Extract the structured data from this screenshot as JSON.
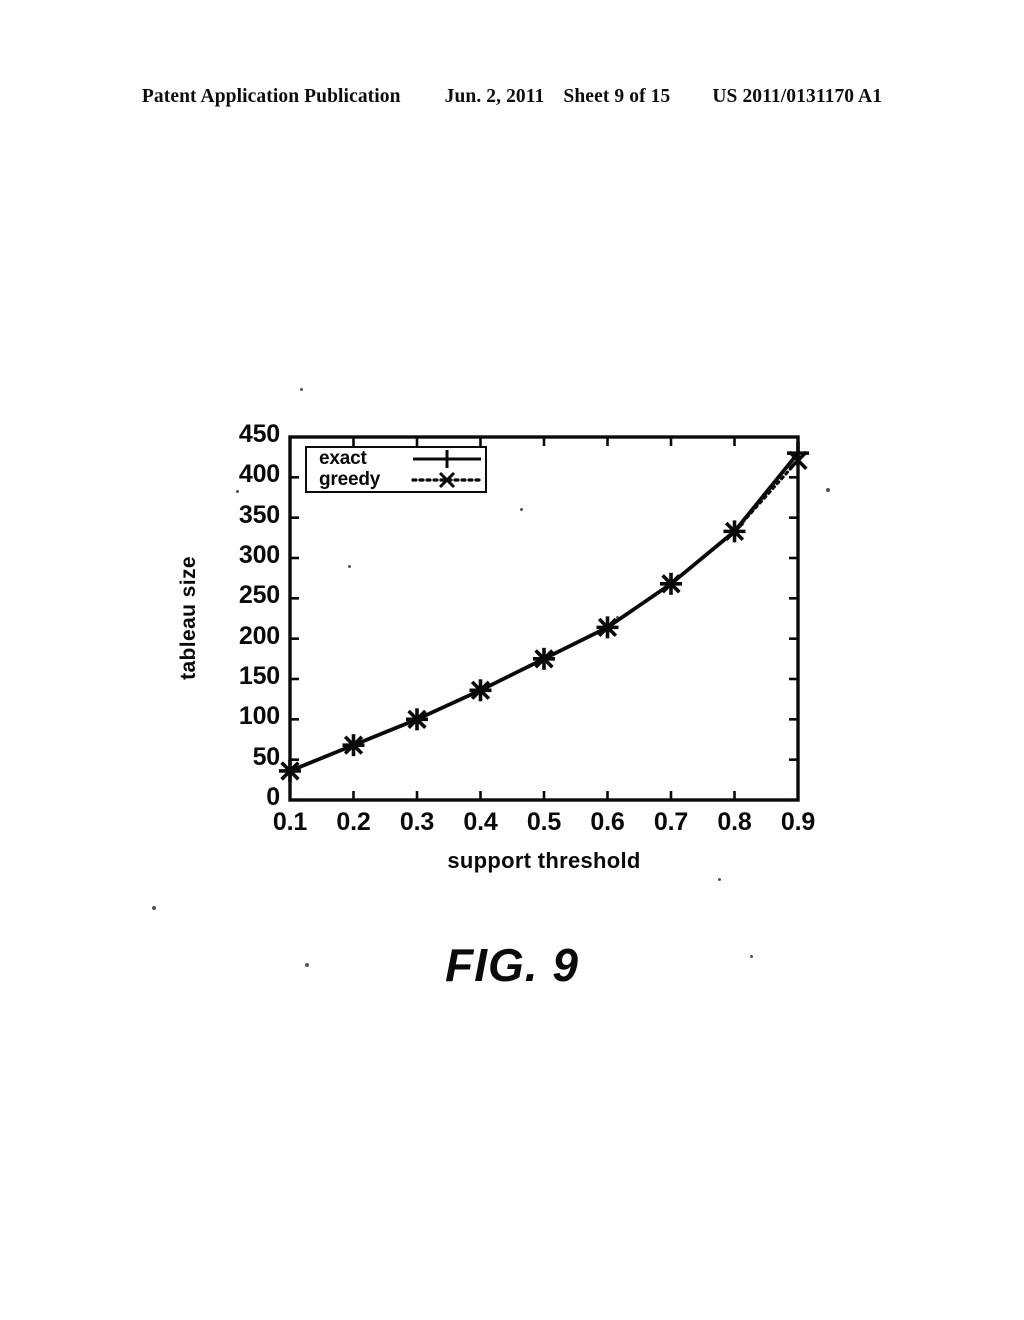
{
  "header": {
    "publication": "Patent Application Publication",
    "date": "Jun. 2, 2011",
    "sheet": "Sheet 9 of 15",
    "patent_number": "US 2011/0131170 A1"
  },
  "figure": {
    "caption": "FIG. 9"
  },
  "chart_data": {
    "type": "line",
    "title": "",
    "xlabel": "support threshold",
    "ylabel": "tableau size",
    "x": [
      0.1,
      0.2,
      0.3,
      0.4,
      0.5,
      0.6,
      0.7,
      0.8,
      0.9
    ],
    "xtick_labels": [
      "0.1",
      "0.2",
      "0.3",
      "0.4",
      "0.5",
      "0.6",
      "0.7",
      "0.8",
      "0.9"
    ],
    "ytick_labels": [
      "0",
      "50",
      "100",
      "150",
      "200",
      "250",
      "300",
      "350",
      "400",
      "450"
    ],
    "yticks": [
      0,
      50,
      100,
      150,
      200,
      250,
      300,
      350,
      400,
      450
    ],
    "xlim": [
      0.1,
      0.9
    ],
    "ylim": [
      0,
      450
    ],
    "grid": false,
    "legend_position": "top-left",
    "series": [
      {
        "name": "exact",
        "marker": "plus",
        "linestyle": "solid",
        "color": "#000000",
        "values": [
          36,
          68,
          100,
          136,
          175,
          214,
          268,
          333,
          430
        ]
      },
      {
        "name": "greedy",
        "marker": "x",
        "linestyle": "dotted",
        "color": "#000000",
        "values": [
          36,
          68,
          100,
          136,
          175,
          214,
          268,
          333,
          421
        ]
      }
    ]
  }
}
